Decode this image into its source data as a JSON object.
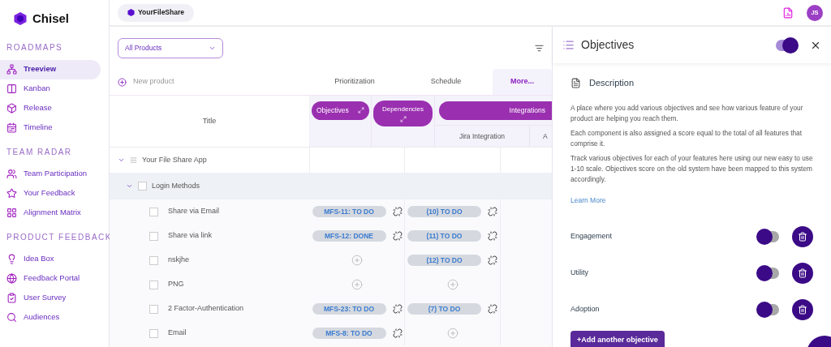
{
  "sidebar": {
    "brand": "Chisel",
    "sections": [
      {
        "title": "ROADMAPS",
        "items": [
          {
            "label": "Treeview",
            "selected": true
          },
          {
            "label": "Kanban",
            "selected": false
          },
          {
            "label": "Release",
            "selected": false
          },
          {
            "label": "Timeline",
            "selected": false
          }
        ]
      },
      {
        "title": "TEAM RADAR",
        "items": [
          {
            "label": "Team Participation",
            "selected": false
          },
          {
            "label": "Your Feedback",
            "selected": false
          },
          {
            "label": "Alignment Matrix",
            "selected": false
          }
        ]
      },
      {
        "title": "PRODUCT FEEDBACK",
        "items": [
          {
            "label": "Idea Box",
            "selected": false
          },
          {
            "label": "Feedback Portal",
            "selected": false
          },
          {
            "label": "User Survey",
            "selected": false
          },
          {
            "label": "Audiences",
            "selected": false
          }
        ]
      }
    ]
  },
  "top_bar": {
    "product": "YourFileShare",
    "avatar": "JS"
  },
  "toolbar": {
    "product_select": "All Products",
    "new_product": "New product"
  },
  "tabs": [
    {
      "label": "Prioritization",
      "selected": false
    },
    {
      "label": "Schedule",
      "selected": false
    },
    {
      "label": "More...",
      "selected": true
    }
  ],
  "table": {
    "title_column": "Title",
    "groups": [
      "Objectives",
      "Dependencies",
      "Integrations"
    ],
    "sub_columns": [
      "Jira Integration",
      "A"
    ],
    "product": {
      "name": "Your File Share App",
      "expanded": true
    },
    "component": {
      "name": "Login Methods",
      "expanded": true,
      "checked": false
    },
    "rows": [
      {
        "title": "Share via Email",
        "checked": false,
        "objective": "MFS-11: TO DO",
        "dependency": "(10) TO DO"
      },
      {
        "title": "Share via link",
        "checked": false,
        "objective": "MFS-12: DONE",
        "dependency": "(11) TO DO"
      },
      {
        "title": "nskjhe",
        "checked": false,
        "dependency": "(12) TO DO"
      },
      {
        "title": "PNG",
        "checked": false
      },
      {
        "title": "2 Factor-Authentication",
        "checked": false,
        "objective": "MFS-23: TO DO",
        "dependency": "(7) TO DO"
      },
      {
        "title": "Email",
        "checked": false,
        "objective": "MFS-8: TO DO"
      }
    ]
  },
  "panel": {
    "title": "Objectives",
    "on": true,
    "description_title": "Description",
    "paragraphs": [
      "A place where you add various objectives and see how various feature of your product are helping you reach them.",
      "Each component is also assigned a score equal to the total of all features that comprise it.",
      "Track various objectives for each of your features here using our new easy to use 1-10 scale. Objectives score on the old system have been mapped to this system accordingly."
    ],
    "link": "Learn More",
    "objectives": [
      {
        "name": "Engagement",
        "on": false
      },
      {
        "name": "Utility",
        "on": false
      },
      {
        "name": "Adoption",
        "on": false
      }
    ],
    "add_button": "+Add another objective"
  }
}
